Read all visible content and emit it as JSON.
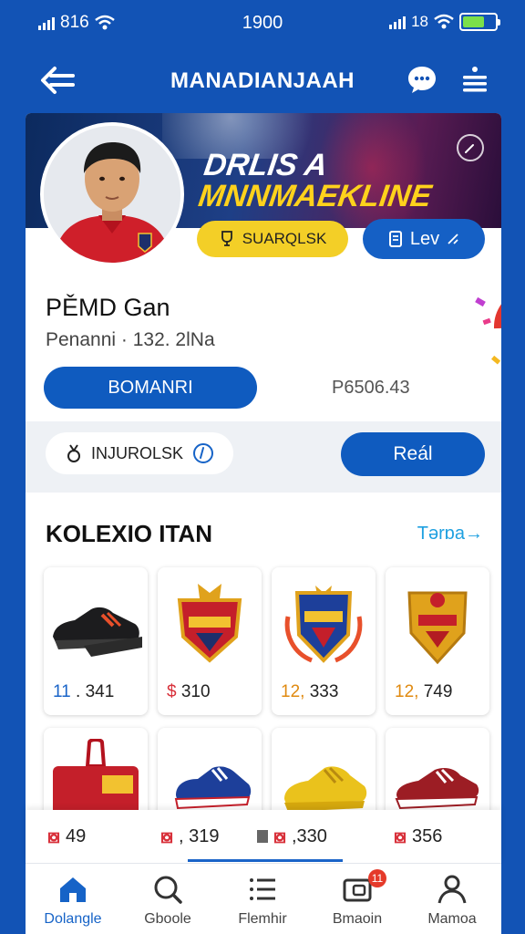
{
  "status": {
    "left": "816",
    "time": "1900",
    "right": "18"
  },
  "header": {
    "title": "MANADIANJAAH"
  },
  "banner": {
    "line1": "DRLIS A",
    "line2": "MNNMAEKLINE"
  },
  "profile": {
    "tag_yellow": "SUARQLSK",
    "tag_blue": "Lev",
    "name": "PĚMD Gan",
    "subtitle": "Penanni · 132. 2lNa",
    "primary_button": "BOMANRI",
    "code": "P6506.43"
  },
  "action_strip": {
    "input_label": "INJUROLSK",
    "button": "Reál"
  },
  "collection": {
    "title": "KOLEXIO ITAN",
    "link": "Tərɒa→",
    "items": [
      {
        "name": "black-sneaker",
        "prefix": "11",
        "value": ". 341",
        "prefix_color": "#1a64c8"
      },
      {
        "name": "red-crest",
        "prefix": "$",
        "value": "310",
        "prefix_color": "#d8303a"
      },
      {
        "name": "blue-crest",
        "prefix": "12,",
        "value": "333",
        "prefix_color": "#e08a10"
      },
      {
        "name": "gold-crest",
        "prefix": "12,",
        "value": "749",
        "prefix_color": "#e08a10"
      }
    ]
  },
  "price_row": [
    {
      "value": "49"
    },
    {
      "value": ", 319"
    },
    {
      "value": ",330"
    },
    {
      "value": "356"
    }
  ],
  "tabs": [
    {
      "label": "Dolangle",
      "icon": "home-icon",
      "active": true
    },
    {
      "label": "Gboole",
      "icon": "search-icon",
      "active": false
    },
    {
      "label": "Flemhir",
      "icon": "list-icon",
      "active": false
    },
    {
      "label": "Bmaoin",
      "icon": "wallet-icon",
      "active": false,
      "badge": "11"
    },
    {
      "label": "Mamoa",
      "icon": "person-icon",
      "active": false
    }
  ],
  "colors": {
    "brand": "#1253b5",
    "accent": "#0f5bbf",
    "yellow": "#f3cf27",
    "red": "#d8303a"
  }
}
